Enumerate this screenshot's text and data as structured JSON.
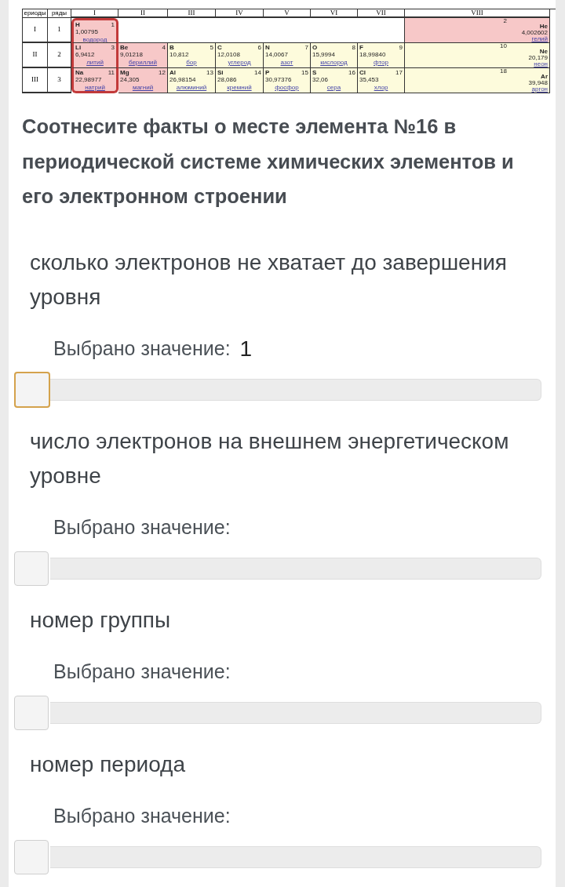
{
  "periodic_table": {
    "header": {
      "periods": "ериоды",
      "rows": "ряды",
      "groups": [
        "I",
        "II",
        "III",
        "IV",
        "V",
        "VI",
        "VII",
        "VIII"
      ]
    },
    "rows": [
      {
        "period": "I",
        "row": "1",
        "cells": [
          {
            "symbol": "H",
            "number": "1",
            "mass": "1,00795",
            "name": "водород",
            "color": "#f7c8c8",
            "highlighted": true
          }
        ],
        "group_8": {
          "symbol": "He",
          "number": "2",
          "mass": "4,002602",
          "name": "гелий",
          "color": "#f7c8c8",
          "highlighted": false
        }
      },
      {
        "period": "II",
        "row": "2",
        "cells": [
          {
            "symbol": "Li",
            "number": "3",
            "mass": "6,9412",
            "name": "литий",
            "color": "#f7c8c8",
            "highlighted": true
          },
          {
            "symbol": "Be",
            "number": "4",
            "mass": "9,01218",
            "name": "бериллий",
            "color": "#f7c8c8",
            "highlighted": false
          },
          {
            "symbol": "B",
            "number": "5",
            "mass": "10,812",
            "name": "бор",
            "color": "#fdfbdc",
            "highlighted": false
          },
          {
            "symbol": "C",
            "number": "6",
            "mass": "12,0108",
            "name": "углерод",
            "color": "#fdfbdc",
            "highlighted": false
          },
          {
            "symbol": "N",
            "number": "7",
            "mass": "14,0067",
            "name": "азот",
            "color": "#fdfbdc",
            "highlighted": false
          },
          {
            "symbol": "O",
            "number": "8",
            "mass": "15,9994",
            "name": "кислород",
            "color": "#fdfbdc",
            "highlighted": false
          },
          {
            "symbol": "F",
            "number": "9",
            "mass": "18,99840",
            "name": "фтор",
            "color": "#fdfbdc",
            "highlighted": false
          }
        ],
        "group_8": {
          "symbol": "Ne",
          "number": "10",
          "mass": "20,179",
          "name": "неон",
          "color": "#fdfbdc",
          "highlighted": false
        }
      },
      {
        "period": "III",
        "row": "3",
        "cells": [
          {
            "symbol": "Na",
            "number": "11",
            "mass": "22,98977",
            "name": "натрий",
            "color": "#f7c8c8",
            "highlighted": true
          },
          {
            "symbol": "Mg",
            "number": "12",
            "mass": "24,305",
            "name": "магний",
            "color": "#f7c8c8",
            "highlighted": false
          },
          {
            "symbol": "Al",
            "number": "13",
            "mass": "26,98154",
            "name": "алюминий",
            "color": "#fdfbdc",
            "highlighted": false
          },
          {
            "symbol": "Si",
            "number": "14",
            "mass": "28,086",
            "name": "кремний",
            "color": "#fdfbdc",
            "highlighted": false
          },
          {
            "symbol": "P",
            "number": "15",
            "mass": "30,97376",
            "name": "фосфор",
            "color": "#fdfbdc",
            "highlighted": false
          },
          {
            "symbol": "S",
            "number": "16",
            "mass": "32,06",
            "name": "сера",
            "color": "#fdfbdc",
            "highlighted": false
          },
          {
            "symbol": "Cl",
            "number": "17",
            "mass": "35,453",
            "name": "хлор",
            "color": "#fdfbdc",
            "highlighted": false
          }
        ],
        "group_8": {
          "symbol": "Ar",
          "number": "18",
          "mass": "39,948",
          "name": "аргон",
          "color": "#fdfbdc",
          "highlighted": false
        }
      }
    ]
  },
  "question": "Соотнесите факты о месте элемента  №16  в периодической системе химических элементов и его электронном строении",
  "items": [
    {
      "label": "сколько электронов не хватает до завершения уровня",
      "caption": "Выбрано значение:",
      "value": "1",
      "slider": {
        "level": 0,
        "focused": true
      }
    },
    {
      "label": "число электронов на внешнем энергетическом уровне",
      "caption": "Выбрано значение:",
      "slider": {
        "level": 0,
        "focused": false
      }
    },
    {
      "label": "номер группы",
      "caption": "Выбрано значение:",
      "slider": {
        "level": 0,
        "focused": false
      }
    },
    {
      "label": "номер периода",
      "caption": "Выбрано значение:",
      "slider": {
        "level": 0,
        "focused": false
      }
    }
  ]
}
